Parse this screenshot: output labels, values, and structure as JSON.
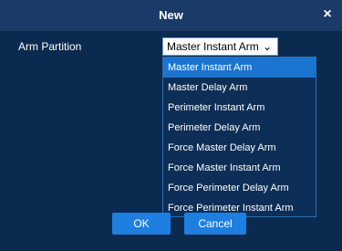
{
  "dialog": {
    "title": "New",
    "close_icon": "close-icon",
    "close_glyph": "×"
  },
  "form": {
    "arm_partition_label": "Arm Partition",
    "arm_partition_value": "Master Instant Arm",
    "chevron_icon": "chevron-down-icon",
    "chevron_glyph": "⌄"
  },
  "dropdown": {
    "options": [
      "Master Instant Arm",
      "Master Delay Arm",
      "Perimeter Instant Arm",
      "Perimeter Delay Arm",
      "Force Master Delay Arm",
      "Force Master Instant Arm",
      "Force Perimeter Delay Arm",
      "Force Perimeter Instant Arm"
    ],
    "selected_index": 0
  },
  "buttons": {
    "ok_label": "OK",
    "cancel_label": "Cancel"
  },
  "colors": {
    "background": "#0a2a4f",
    "titlebar": "#1a3a68",
    "accent": "#1e7fe0",
    "selected_option": "#1b75d0"
  }
}
